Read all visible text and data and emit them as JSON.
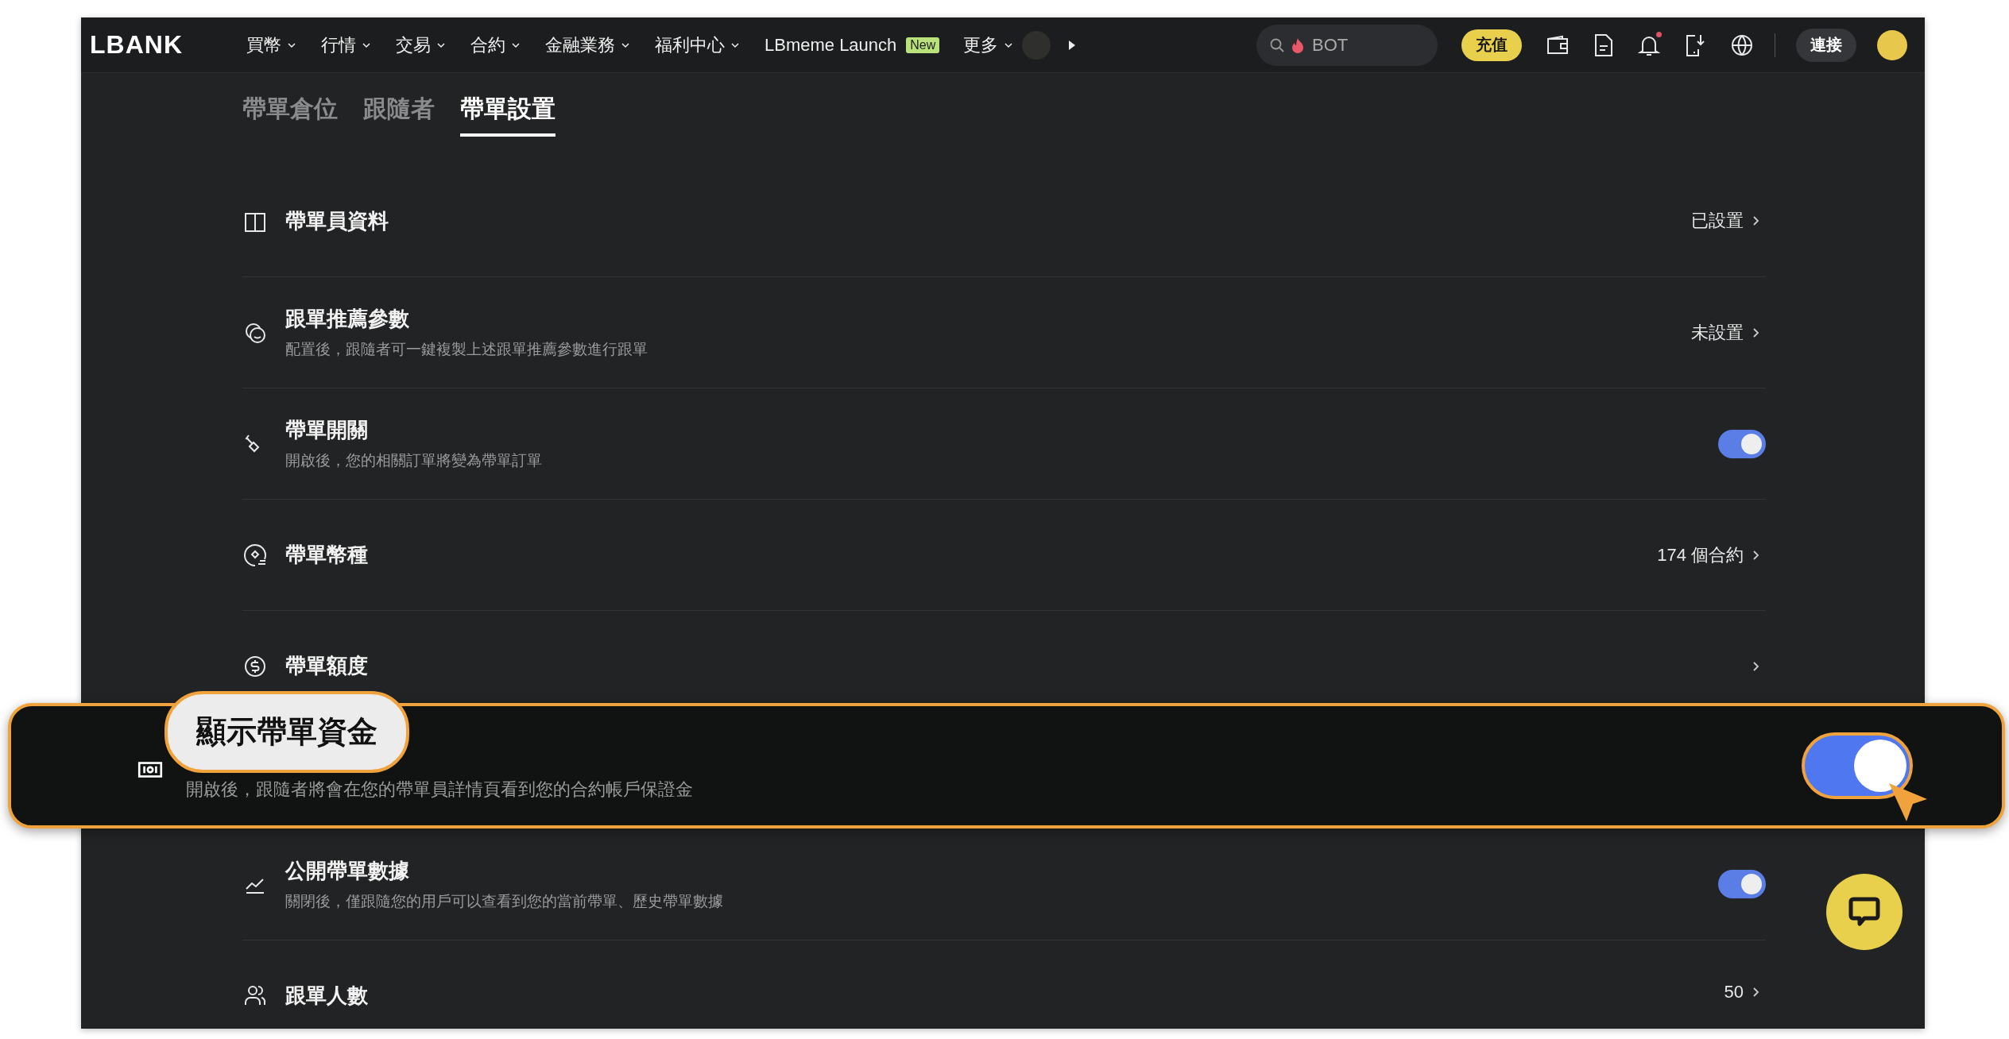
{
  "nav": {
    "logo": "LBANK",
    "items": [
      {
        "label": "買幣",
        "dropdown": true
      },
      {
        "label": "行情",
        "dropdown": true
      },
      {
        "label": "交易",
        "dropdown": true
      },
      {
        "label": "合約",
        "dropdown": true
      },
      {
        "label": "金融業務",
        "dropdown": true
      },
      {
        "label": "福利中心",
        "dropdown": true
      },
      {
        "label": "LBmeme Launch",
        "dropdown": false,
        "badge": "New"
      },
      {
        "label": "更多",
        "dropdown": true
      }
    ],
    "search": {
      "value": "BOT"
    },
    "deposit": "充值",
    "connect": "連接",
    "notification_dot": true
  },
  "tabs": [
    {
      "label": "帶單倉位",
      "selected": false
    },
    {
      "label": "跟隨者",
      "selected": false
    },
    {
      "label": "帶單設置",
      "selected": true
    }
  ],
  "rows": [
    {
      "kind": "link",
      "title": "帶單員資料",
      "value": "已設置"
    },
    {
      "kind": "link",
      "title": "跟單推薦參數",
      "description": "配置後，跟隨者可一鍵複製上述跟單推薦參數進行跟單",
      "value": "未設置"
    },
    {
      "kind": "toggle",
      "title": "帶單開關",
      "description": "開啟後，您的相關訂單將變為帶單訂單",
      "on": true
    },
    {
      "kind": "link",
      "title": "帶單幣種",
      "value": "174 個合約"
    },
    {
      "kind": "link",
      "title": "帶單額度"
    },
    {
      "kind": "toggle",
      "title": "顯示帶單資金",
      "description": "開啟後，跟隨者將會在您的帶單員詳情頁看到您的合約帳戶保證金",
      "on": true,
      "highlighted": true
    },
    {
      "kind": "toggle",
      "title": "公開帶單數據",
      "description": "關閉後，僅跟隨您的用戶可以查看到您的當前帶單、歷史帶單數據",
      "on": true
    },
    {
      "kind": "link",
      "title": "跟單人數",
      "value": "50"
    }
  ]
}
